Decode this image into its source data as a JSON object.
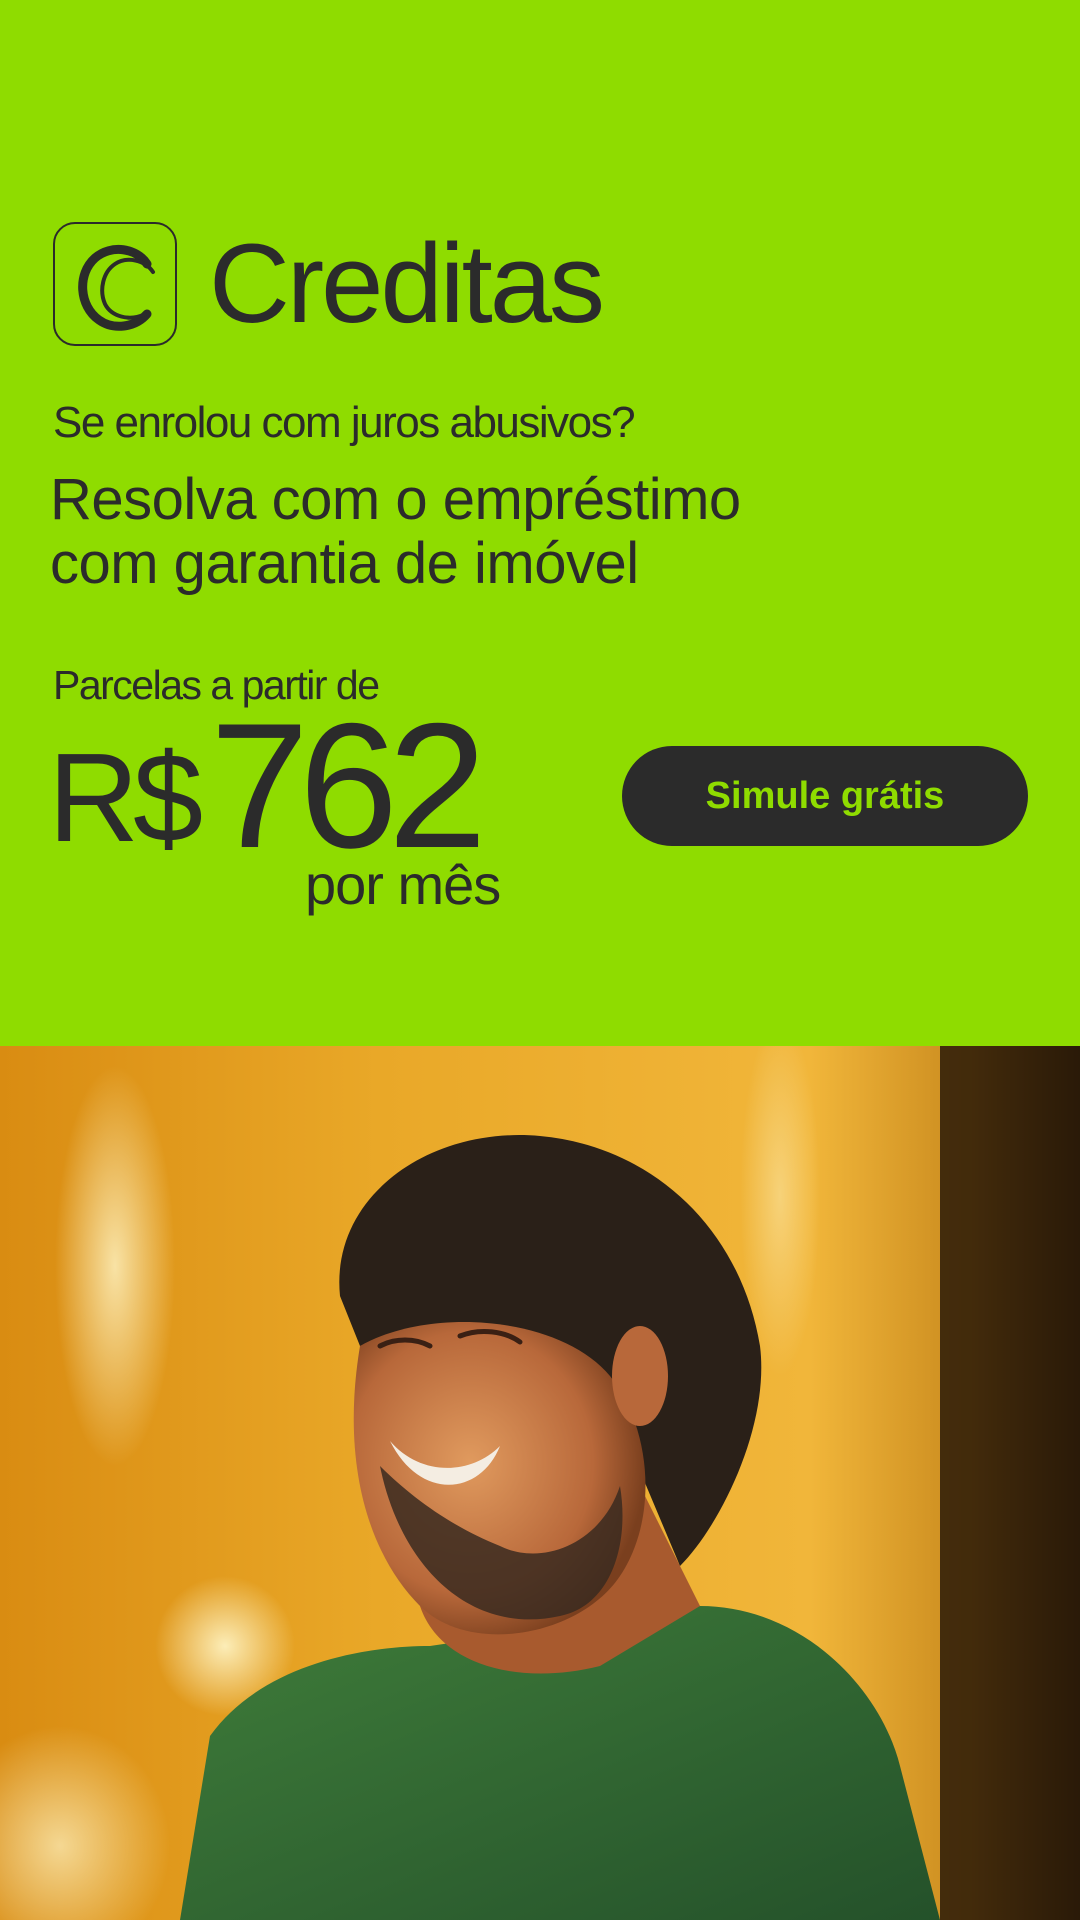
{
  "brand": {
    "name": "Creditas",
    "logo_icon": "creditas-c-logo-icon"
  },
  "headline": {
    "kicker": "Se enrolou com juros abusivos?",
    "line1": "Resolva com o empréstimo",
    "line2": "com garantia de imóvel"
  },
  "price": {
    "label": "Parcelas a partir de",
    "currency": "R$",
    "amount": "762",
    "period": "por mês"
  },
  "cta": {
    "label": "Simule grátis"
  },
  "colors": {
    "brand_green": "#8fdc00",
    "dark": "#2b2b2b"
  },
  "photo": {
    "subject": "smiling man in green t-shirt"
  }
}
